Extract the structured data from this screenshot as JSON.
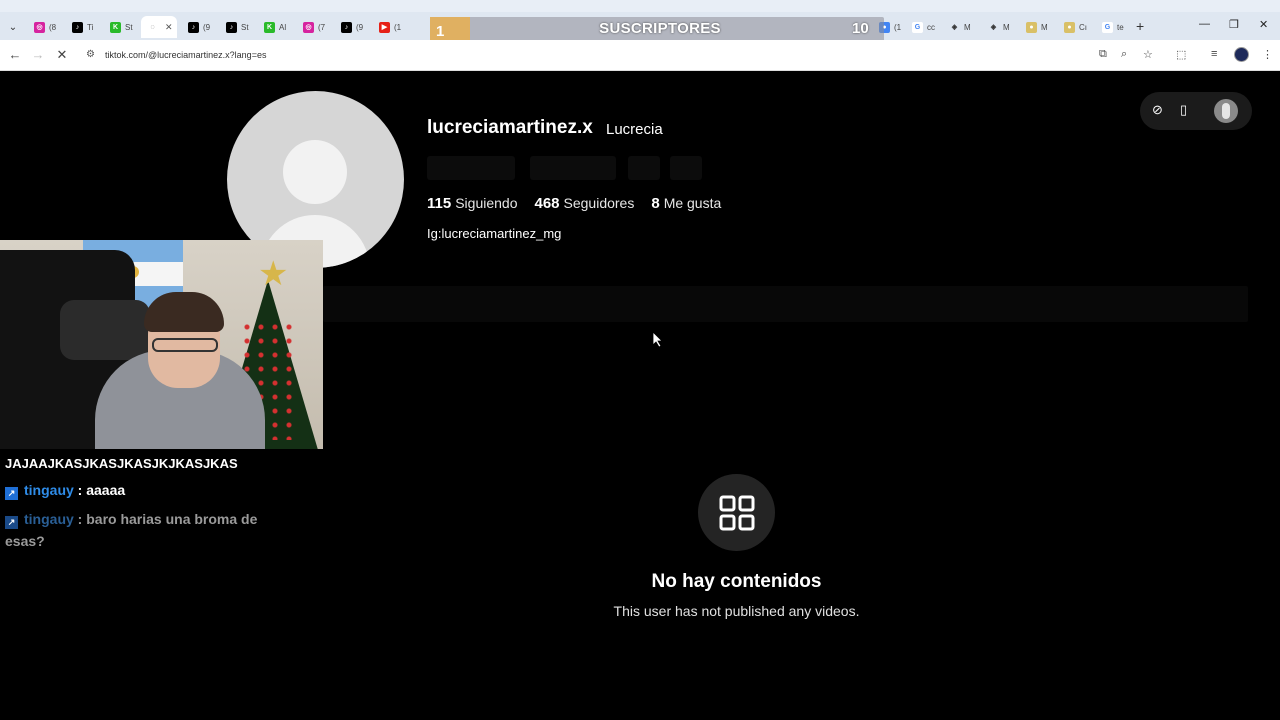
{
  "browser": {
    "url": "tiktok.com/@lucreciamartinez.x?lang=es",
    "tabs": [
      {
        "label": "(8",
        "icon": "instagram-icon",
        "color": "#d6249f"
      },
      {
        "label": "Ti",
        "icon": "tiktok-icon",
        "color": "#000000"
      },
      {
        "label": "St",
        "icon": "kick-icon",
        "color": "#2aba2a"
      },
      {
        "label": "",
        "icon": "loading-icon",
        "color": "#555555",
        "active": true
      },
      {
        "label": "(9",
        "icon": "tiktok-icon",
        "color": "#000000"
      },
      {
        "label": "St",
        "icon": "tiktok-icon",
        "color": "#000000"
      },
      {
        "label": "Al",
        "icon": "kick-icon",
        "color": "#2aba2a"
      },
      {
        "label": "(7",
        "icon": "instagram-icon",
        "color": "#d6249f"
      },
      {
        "label": "(9",
        "icon": "tiktok-icon",
        "color": "#000000"
      },
      {
        "label": "(1",
        "icon": "youtube-icon",
        "color": "#e62117"
      }
    ],
    "right_tabs": [
      {
        "label": "(1",
        "icon": "chrome-icon"
      },
      {
        "label": "cc",
        "icon": "google-icon"
      },
      {
        "label": "M",
        "icon": "game-icon"
      },
      {
        "label": "M",
        "icon": "game-icon"
      },
      {
        "label": "M",
        "icon": "coin-icon"
      },
      {
        "label": "Cı",
        "icon": "coin-icon"
      },
      {
        "label": "te",
        "icon": "google-icon"
      }
    ],
    "new_tab": "+"
  },
  "overlay": {
    "sub_left": "1",
    "sub_label": "SUSCRIPTORES",
    "sub_right": "10"
  },
  "profile": {
    "username": "lucreciamartinez.x",
    "nickname": "Lucrecia",
    "following_count": "115",
    "following_label": "Siguiendo",
    "followers_count": "468",
    "followers_label": "Seguidores",
    "likes_count": "8",
    "likes_label": "Me gusta",
    "bio": "Ig:lucreciamartinez_mg"
  },
  "empty_state": {
    "title": "No hay contenidos",
    "subtitle": "This user has not published any videos."
  },
  "chat": {
    "line1": "JAJAAJKASJKASJKASJKJKASJKAS",
    "messages": [
      {
        "user": "tingauy",
        "sep": " : ",
        "text": "aaaaa",
        "faded": false
      },
      {
        "user": "tingauy",
        "sep": " : ",
        "text": "baro harias una broma de esas?",
        "faded": true
      }
    ]
  }
}
